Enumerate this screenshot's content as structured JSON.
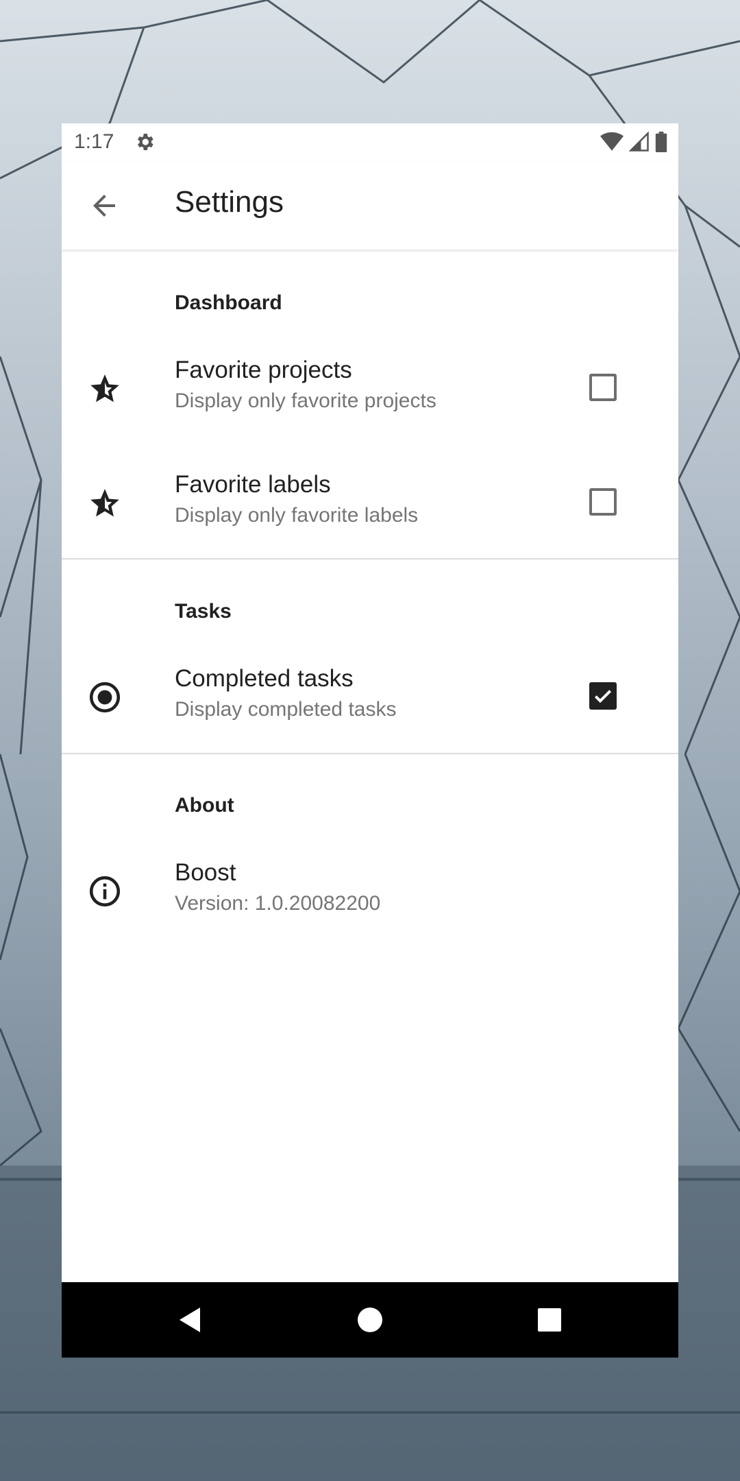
{
  "status_bar": {
    "time": "1:17",
    "icons": [
      "settings-icon",
      "wifi-icon",
      "signal-icon",
      "battery-icon"
    ]
  },
  "app_bar": {
    "title": "Settings",
    "back_icon": "arrow-back-icon"
  },
  "sections": {
    "dashboard": {
      "header": "Dashboard",
      "items": [
        {
          "icon": "star-icon",
          "title": "Favorite projects",
          "summary": "Display only favorite projects",
          "checked": false
        },
        {
          "icon": "star-icon",
          "title": "Favorite labels",
          "summary": "Display only favorite labels",
          "checked": false
        }
      ]
    },
    "tasks": {
      "header": "Tasks",
      "items": [
        {
          "icon": "radio-button-icon",
          "title": "Completed tasks",
          "summary": "Display completed tasks",
          "checked": true
        }
      ]
    },
    "about": {
      "header": "About",
      "items": [
        {
          "icon": "info-icon",
          "title": "Boost",
          "summary": "Version: 1.0.20082200"
        }
      ]
    }
  },
  "nav_bar": {
    "buttons": [
      "back-triangle-icon",
      "home-circle-icon",
      "recents-square-icon"
    ]
  },
  "colors": {
    "text_primary": "#212121",
    "text_secondary": "#757575",
    "checkbox_checked": "#212121",
    "nav_bar": "#000000"
  }
}
